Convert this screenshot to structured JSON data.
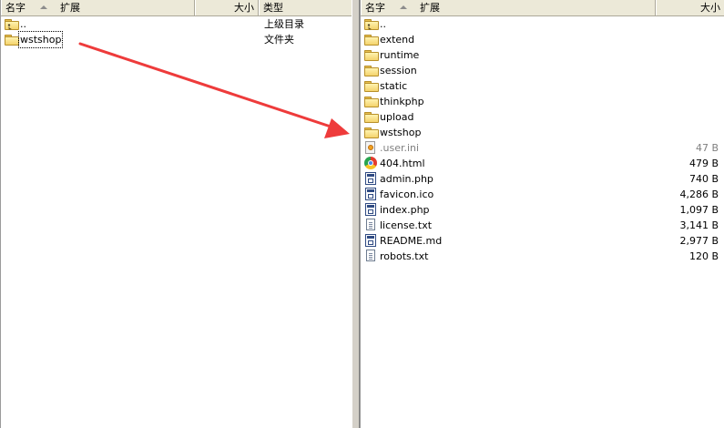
{
  "left_pane": {
    "columns": {
      "name": "名字",
      "ext": "扩展",
      "size": "大小",
      "type": "类型"
    },
    "rows": [
      {
        "name": "..",
        "type": "上级目录",
        "icon": "up-folder-icon"
      },
      {
        "name": "wstshop",
        "type": "文件夹",
        "icon": "folder-icon"
      }
    ]
  },
  "right_pane": {
    "columns": {
      "name": "名字",
      "ext": "扩展",
      "size": "大小"
    },
    "rows": [
      {
        "name": "..",
        "size": "",
        "icon": "up-folder-icon"
      },
      {
        "name": "extend",
        "size": "",
        "icon": "folder-icon"
      },
      {
        "name": "runtime",
        "size": "",
        "icon": "folder-icon"
      },
      {
        "name": "session",
        "size": "",
        "icon": "folder-icon"
      },
      {
        "name": "static",
        "size": "",
        "icon": "folder-icon"
      },
      {
        "name": "thinkphp",
        "size": "",
        "icon": "folder-icon"
      },
      {
        "name": "upload",
        "size": "",
        "icon": "folder-icon"
      },
      {
        "name": "wstshop",
        "size": "",
        "icon": "folder-icon"
      },
      {
        "name": ".user.ini",
        "size": "47 B",
        "icon": "ini-file-icon"
      },
      {
        "name": "404.html",
        "size": "479 B",
        "icon": "chrome-html-icon"
      },
      {
        "name": "admin.php",
        "size": "740 B",
        "icon": "php-file-icon"
      },
      {
        "name": "favicon.ico",
        "size": "4,286 B",
        "icon": "ico-file-icon"
      },
      {
        "name": "index.php",
        "size": "1,097 B",
        "icon": "php-file-icon"
      },
      {
        "name": "license.txt",
        "size": "3,141 B",
        "icon": "text-file-icon"
      },
      {
        "name": "README.md",
        "size": "2,977 B",
        "icon": "md-file-icon"
      },
      {
        "name": "robots.txt",
        "size": "120 B",
        "icon": "text-file-icon"
      }
    ]
  },
  "colors": {
    "arrow": "#ee3b3b",
    "header_bg": "#ece9d8",
    "splitter": "#d4d0c8",
    "hidden_file_text": "#808080"
  }
}
